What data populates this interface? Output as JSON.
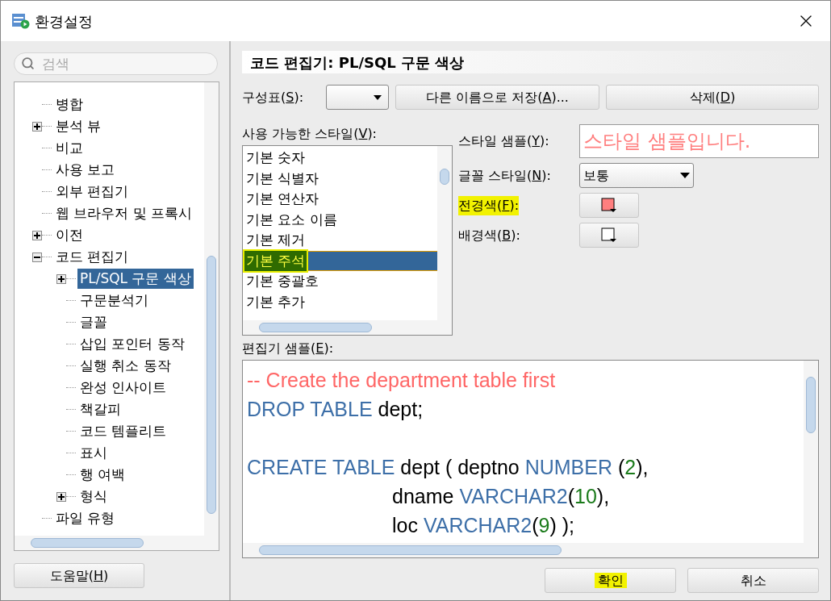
{
  "window": {
    "title": "환경설정"
  },
  "search": {
    "placeholder": "검색"
  },
  "tree": [
    {
      "label": "병합",
      "kind": "leaf",
      "selected": false
    },
    {
      "label": "분석 뷰",
      "kind": "node",
      "expanded": false,
      "selected": false
    },
    {
      "label": "비교",
      "kind": "leaf",
      "selected": false
    },
    {
      "label": "사용 보고",
      "kind": "leaf",
      "selected": false
    },
    {
      "label": "외부 편집기",
      "kind": "leaf",
      "selected": false
    },
    {
      "label": "웹 브라우저 및 프록시",
      "kind": "leaf",
      "selected": false
    },
    {
      "label": "이전",
      "kind": "node",
      "expanded": false,
      "selected": false
    },
    {
      "label": "코드 편집기",
      "kind": "node",
      "expanded": true,
      "selected": false,
      "children": [
        {
          "label": "PL/SQL 구문 색상",
          "kind": "node",
          "expanded": false,
          "selected": true
        },
        {
          "label": "구문분석기",
          "kind": "leaf",
          "selected": false
        },
        {
          "label": "글꼴",
          "kind": "leaf",
          "selected": false
        },
        {
          "label": "삽입 포인터 동작",
          "kind": "leaf",
          "selected": false
        },
        {
          "label": "실행 취소 동작",
          "kind": "leaf",
          "selected": false
        },
        {
          "label": "완성 인사이트",
          "kind": "leaf",
          "selected": false
        },
        {
          "label": "책갈피",
          "kind": "leaf",
          "selected": false
        },
        {
          "label": "코드 템플리트",
          "kind": "leaf",
          "selected": false
        },
        {
          "label": "표시",
          "kind": "leaf",
          "selected": false
        },
        {
          "label": "행 여백",
          "kind": "leaf",
          "selected": false
        },
        {
          "label": "형식",
          "kind": "node",
          "expanded": false,
          "selected": false
        }
      ]
    },
    {
      "label": "파일 유형",
      "kind": "leaf",
      "selected": false
    }
  ],
  "help_button": [
    "도움말(",
    "H",
    ")"
  ],
  "header": "코드 편집기: PL/SQL 구문 색상",
  "scheme": {
    "label": [
      "구성표(",
      "S",
      "):"
    ],
    "save_as": [
      "다른 이름으로 저장(",
      "A",
      ")..."
    ],
    "delete": [
      "삭제(",
      "D",
      ")"
    ]
  },
  "styles": {
    "label": [
      "사용 가능한 스타일(",
      "V",
      "):"
    ],
    "items": [
      {
        "text": "기본 숫자",
        "selected": false,
        "highlighted": false
      },
      {
        "text": "기본 식별자",
        "selected": false,
        "highlighted": false
      },
      {
        "text": "기본 연산자",
        "selected": false,
        "highlighted": false
      },
      {
        "text": "기본 요소 이름",
        "selected": false,
        "highlighted": false
      },
      {
        "text": "기본 제거",
        "selected": false,
        "highlighted": false
      },
      {
        "text": "기본 주석",
        "selected": true,
        "highlighted": true
      },
      {
        "text": "기본 중괄호",
        "selected": false,
        "highlighted": false
      },
      {
        "text": "기본 추가",
        "selected": false,
        "highlighted": false
      }
    ]
  },
  "style_sample": {
    "label": [
      "스타일 샘플(",
      "Y",
      "):"
    ],
    "value": "스타일 샘플입니다.",
    "color": "#ff7f7f"
  },
  "font_style": {
    "label": [
      "글꼴 스타일(",
      "N",
      "):"
    ],
    "value": "보통"
  },
  "foreground": {
    "label": [
      "전경색(",
      "F",
      "):"
    ],
    "highlighted": true,
    "color": "#ff7f7f"
  },
  "background": {
    "label": [
      "배경색(",
      "B",
      "):"
    ],
    "highlighted": false,
    "color": "#ffffff"
  },
  "editor_sample": {
    "label": [
      "편집기 샘플(",
      "E",
      "):"
    ],
    "lines": [
      [
        {
          "kind": "comment",
          "text": "-- Create the department table first"
        }
      ],
      [
        {
          "kind": "keyword",
          "text": "DROP TABLE "
        },
        {
          "kind": "ident",
          "text": "dept;"
        }
      ],
      [
        {
          "kind": "blank"
        }
      ],
      [
        {
          "kind": "keyword",
          "text": "CREATE TABLE "
        },
        {
          "kind": "ident",
          "text": "dept ( deptno "
        },
        {
          "kind": "keyword",
          "text": "NUMBER "
        },
        {
          "kind": "ident",
          "text": "("
        },
        {
          "kind": "number",
          "text": "2"
        },
        {
          "kind": "ident",
          "text": "),"
        }
      ],
      [
        {
          "kind": "indent"
        },
        {
          "kind": "ident",
          "text": "dname "
        },
        {
          "kind": "keyword",
          "text": "VARCHAR2"
        },
        {
          "kind": "ident",
          "text": "("
        },
        {
          "kind": "number",
          "text": "10"
        },
        {
          "kind": "ident",
          "text": "),"
        }
      ],
      [
        {
          "kind": "indent"
        },
        {
          "kind": "ident",
          "text": "loc "
        },
        {
          "kind": "keyword",
          "text": "VARCHAR2"
        },
        {
          "kind": "ident",
          "text": "("
        },
        {
          "kind": "number",
          "text": "9"
        },
        {
          "kind": "ident",
          "text": ") );"
        }
      ]
    ]
  },
  "ok_button": {
    "label": "확인",
    "highlighted": true
  },
  "cancel_button": {
    "label": "취소",
    "highlighted": false
  }
}
